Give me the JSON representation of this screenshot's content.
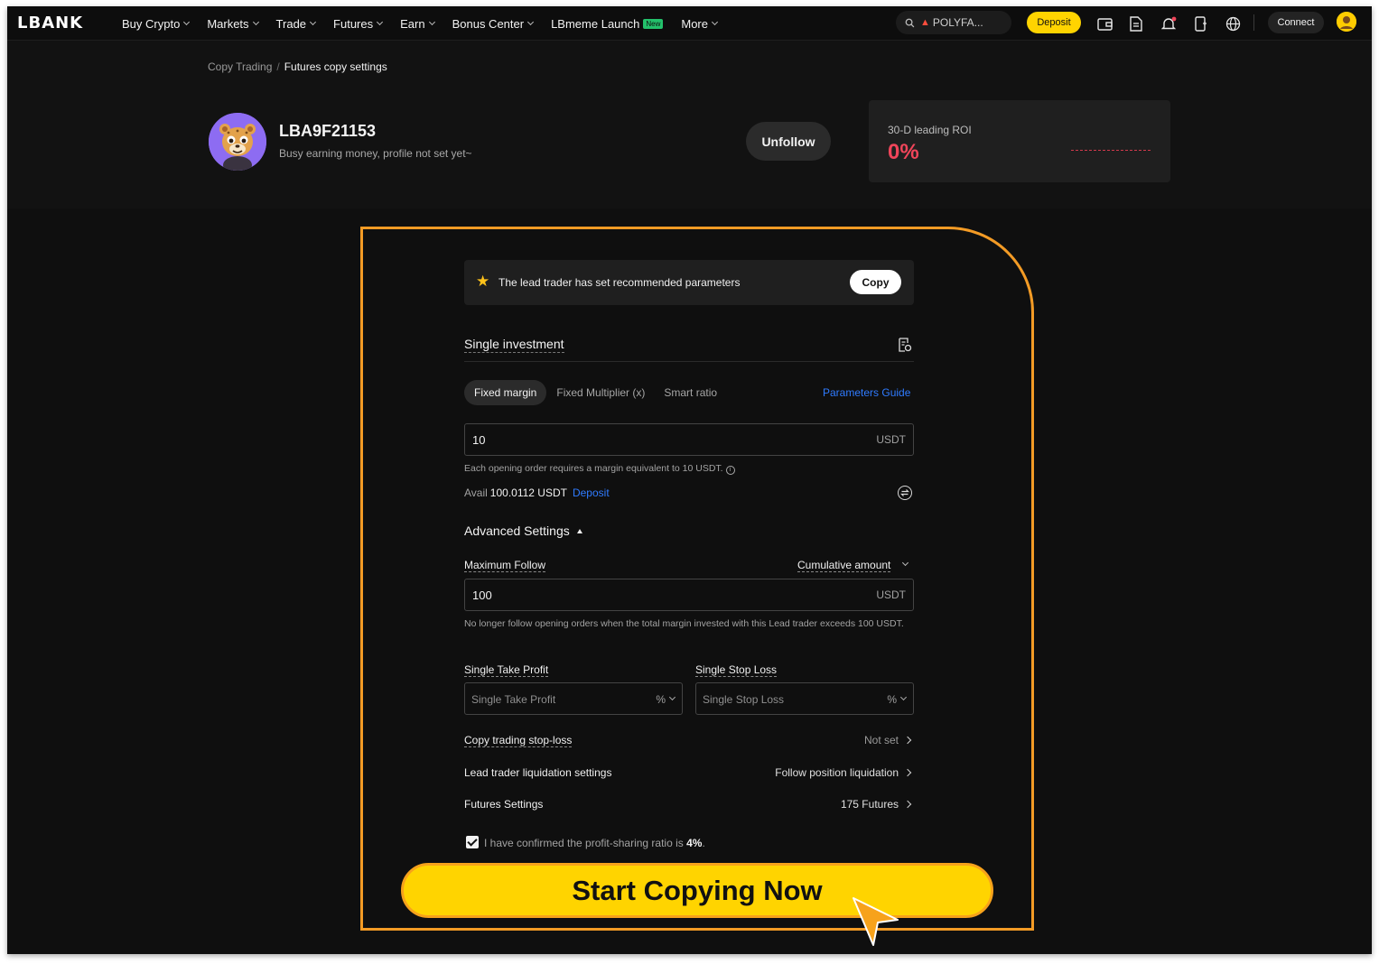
{
  "nav": {
    "logo": "LBANK",
    "items": [
      {
        "label": "Buy Crypto",
        "caret": true
      },
      {
        "label": "Markets",
        "caret": true
      },
      {
        "label": "Trade",
        "caret": true
      },
      {
        "label": "Futures",
        "caret": true
      },
      {
        "label": "Earn",
        "caret": true
      },
      {
        "label": "Bonus Center",
        "caret": true
      },
      {
        "label": "LBmeme Launch",
        "badge": "New",
        "caret": false
      },
      {
        "label": "More",
        "caret": true
      }
    ],
    "search_text": "POLYFA...",
    "deposit_label": "Deposit",
    "connect_label": "Connect",
    "icons": [
      "search-icon",
      "flame-icon",
      "wallet-icon",
      "orders-icon",
      "bell-icon",
      "download-icon",
      "globe-icon"
    ]
  },
  "breadcrumb": {
    "parent": "Copy Trading",
    "separator": "/",
    "current": "Futures copy settings"
  },
  "profile": {
    "name": "LBA9F21153",
    "bio": "Busy earning money, profile not set yet~",
    "unfollow_label": "Unfollow"
  },
  "roi": {
    "label": "30-D leading ROI",
    "value": "0%"
  },
  "recommend": {
    "text": "The lead trader has set recommended parameters",
    "copy_label": "Copy"
  },
  "single_investment": {
    "title": "Single investment",
    "tabs": [
      "Fixed margin",
      "Fixed Multiplier (x)",
      "Smart ratio"
    ],
    "active_tab": 0,
    "guide_label": "Parameters Guide",
    "margin_value": "10",
    "unit": "USDT",
    "hint": "Each opening order requires a margin equivalent to 10 USDT.",
    "avail_label": "Avail",
    "avail_amount": "100.0112 USDT",
    "deposit_label": "Deposit"
  },
  "advanced": {
    "title": "Advanced Settings",
    "max_follow_label": "Maximum Follow",
    "cumulative_label": "Cumulative amount",
    "max_follow_value": "100",
    "unit": "USDT",
    "max_follow_hint": "No longer follow opening orders when the total margin invested with this Lead trader exceeds 100 USDT.",
    "take_profit_label": "Single Take Profit",
    "take_profit_placeholder": "Single Take Profit",
    "stop_loss_label": "Single Stop Loss",
    "stop_loss_placeholder": "Single Stop Loss",
    "percent_unit": "%",
    "rows": [
      {
        "label": "Copy trading stop-loss",
        "value": "Not set",
        "muted": true,
        "dashed": true
      },
      {
        "label": "Lead trader liquidation settings",
        "value": "Follow position liquidation",
        "muted": false,
        "dashed": false
      },
      {
        "label": "Futures Settings",
        "value": "175 Futures",
        "muted": false,
        "dashed": false
      }
    ]
  },
  "confirm": {
    "text": "I have confirmed the profit-sharing ratio is",
    "ratio": "4%",
    "suffix": ".",
    "checked": true
  },
  "cta": {
    "label": "Start Copying Now"
  },
  "colors": {
    "accent_yellow": "#ffd400",
    "highlight_orange": "#f39b25",
    "link_blue": "#2f7bff",
    "roi_red": "#f0455a",
    "background": "#0f0f0f"
  }
}
